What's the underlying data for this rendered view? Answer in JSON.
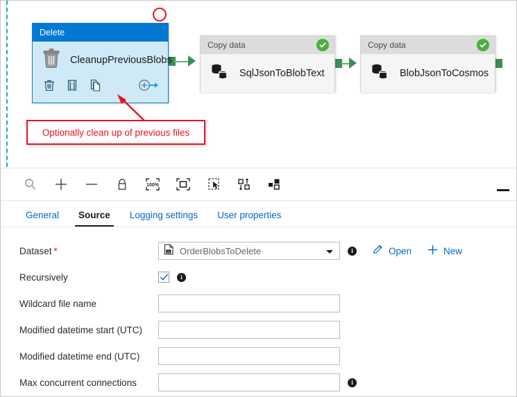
{
  "canvas": {
    "nodes": [
      {
        "id": "delete-activity",
        "type_label": "Delete",
        "name": "CleanupPreviousBlobs",
        "selected": true,
        "actions": [
          "trash-icon",
          "code-braces-icon",
          "copy-icon",
          "add-output-icon"
        ]
      },
      {
        "id": "copy-data-1",
        "type_label": "Copy data",
        "name": "SqlJsonToBlobText",
        "status": "success"
      },
      {
        "id": "copy-data-2",
        "type_label": "Copy data",
        "name": "BlobJsonToCosmos",
        "status": "success"
      }
    ],
    "annotations": {
      "callout_text": "Optionally clean up of previous files",
      "callout_color": "#e81123",
      "circle_color": "#e81123"
    }
  },
  "toolbar": {
    "buttons": [
      {
        "name": "zoom-search-icon",
        "tooltip": "Zoom to fit"
      },
      {
        "name": "zoom-in-icon",
        "tooltip": "Zoom in"
      },
      {
        "name": "zoom-out-icon",
        "tooltip": "Zoom out"
      },
      {
        "name": "lock-icon",
        "tooltip": "Lock canvas"
      },
      {
        "name": "zoom-100-percent-icon",
        "tooltip": "100%",
        "label": "100%"
      },
      {
        "name": "fit-to-screen-icon",
        "tooltip": "Fit to screen"
      },
      {
        "name": "marquee-select-icon",
        "tooltip": "Marquee select"
      },
      {
        "name": "auto-align-icon",
        "tooltip": "Auto align"
      },
      {
        "name": "layout-icon",
        "tooltip": "Layout"
      }
    ],
    "minimize": "minimize-icon"
  },
  "tabs": [
    {
      "label": "General",
      "active": false
    },
    {
      "label": "Source",
      "active": true
    },
    {
      "label": "Logging settings",
      "active": false
    },
    {
      "label": "User properties",
      "active": false
    }
  ],
  "source_form": {
    "dataset": {
      "label": "Dataset",
      "required_marker": "*",
      "value": "OrderBlobsToDelete",
      "icon": "dataset-file-icon",
      "open_label": "Open",
      "new_label": "New"
    },
    "recursively": {
      "label": "Recursively",
      "checked": true
    },
    "wildcard_file_name": {
      "label": "Wildcard file name",
      "value": "",
      "placeholder": ""
    },
    "modified_datetime_start": {
      "label": "Modified datetime start (UTC)",
      "value": "",
      "placeholder": ""
    },
    "modified_datetime_end": {
      "label": "Modified datetime end (UTC)",
      "value": "",
      "placeholder": ""
    },
    "max_concurrent_connections": {
      "label": "Max concurrent connections",
      "value": "",
      "placeholder": ""
    }
  },
  "colors": {
    "accent_blue": "#0078d4",
    "link_blue": "#0066cc",
    "node_selected_fill": "#cfe9f7",
    "node_header_blue": "#0078d4",
    "copy_node_fill": "#f5f5f5",
    "connector_green": "#3c8f55",
    "status_green": "#4caf3f",
    "annotation_red": "#e81123",
    "canvas_edge_cyan": "#1aa3d8"
  }
}
